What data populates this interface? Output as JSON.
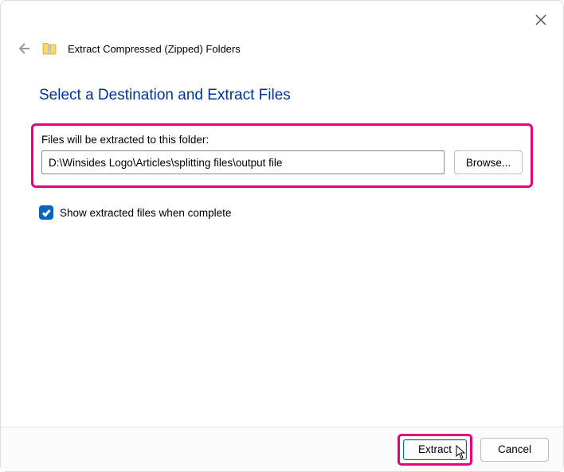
{
  "window": {
    "title": "Extract Compressed (Zipped) Folders"
  },
  "heading": "Select a Destination and Extract Files",
  "destination": {
    "label": "Files will be extracted to this folder:",
    "path": "D:\\Winsides Logo\\Articles\\splitting files\\output file",
    "browse_label": "Browse..."
  },
  "checkbox": {
    "label": "Show extracted files when complete",
    "checked": true
  },
  "footer": {
    "extract_label": "Extract",
    "cancel_label": "Cancel"
  }
}
